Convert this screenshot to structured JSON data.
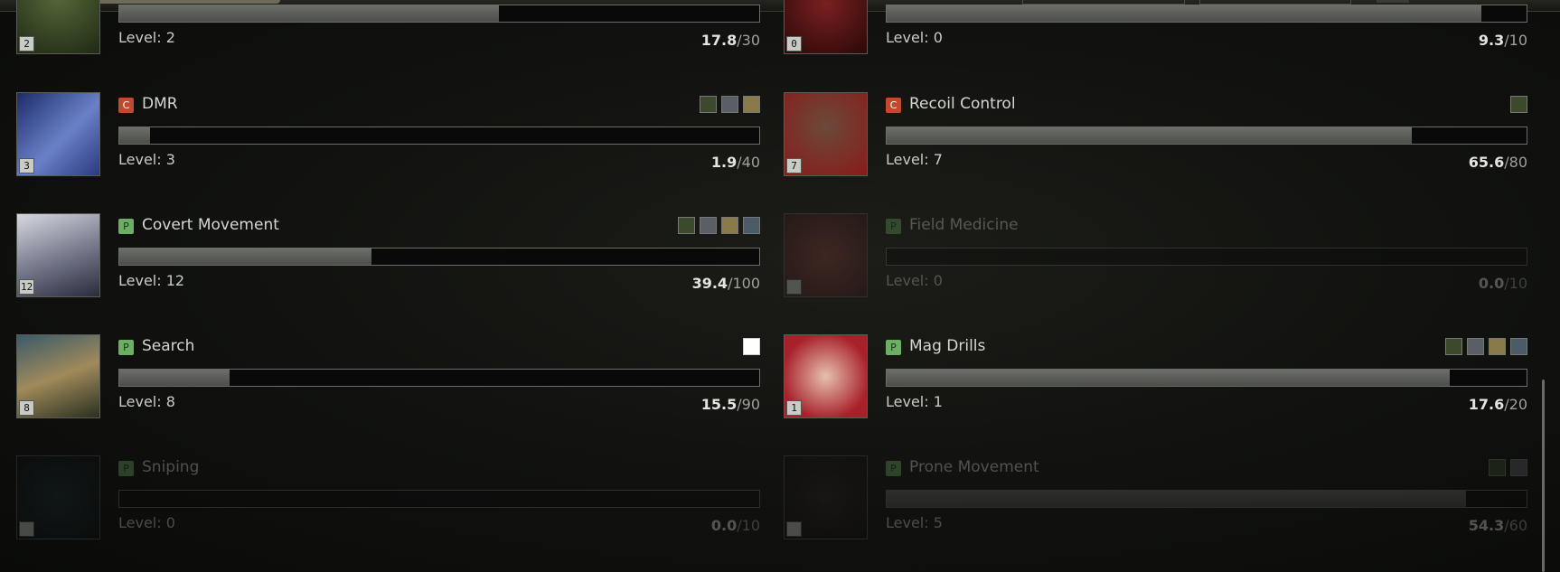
{
  "skills": [
    {
      "name": "",
      "tag": "",
      "level_label": "Level: 2",
      "badge": "2",
      "current": "17.8",
      "max": "/30",
      "progress": 0.593,
      "locked": false,
      "buff_icons": [],
      "icon": "helmet-skill-icon"
    },
    {
      "name": "",
      "tag": "",
      "level_label": "Level: 0",
      "badge": "0",
      "current": "9.3",
      "max": "/10",
      "progress": 0.93,
      "locked": false,
      "buff_icons": [],
      "icon": "rifle-skill-icon"
    },
    {
      "name": "DMR",
      "tag": "C",
      "level_label": "Level: 3",
      "badge": "3",
      "current": "1.9",
      "max": "/40",
      "progress": 0.048,
      "locked": false,
      "buff_icons": [
        "reload-buff-icon",
        "crosshair-buff-icon",
        "rifle-buff-icon"
      ],
      "icon": "dmr-skill-icon"
    },
    {
      "name": "Recoil Control",
      "tag": "C",
      "level_label": "Level: 7",
      "badge": "7",
      "current": "65.6",
      "max": "/80",
      "progress": 0.82,
      "locked": false,
      "buff_icons": [
        "recoil-buff-icon"
      ],
      "icon": "recoil-control-skill-icon"
    },
    {
      "name": "Covert Movement",
      "tag": "P",
      "level_label": "Level: 12",
      "badge": "12",
      "current": "39.4",
      "max": "/100",
      "progress": 0.394,
      "locked": false,
      "buff_icons": [
        "sneak-buff-icon",
        "sneak-buff-icon",
        "stealth-buff-icon",
        "walk-buff-icon"
      ],
      "icon": "covert-movement-skill-icon"
    },
    {
      "name": "Field Medicine",
      "tag": "P",
      "level_label": "Level: 0",
      "badge": "",
      "current": "0.0",
      "max": "/10",
      "progress": 0,
      "locked": true,
      "buff_icons": [],
      "icon": "field-medicine-skill-icon"
    },
    {
      "name": "Search",
      "tag": "P",
      "level_label": "Level: 8",
      "badge": "8",
      "current": "15.5",
      "max": "/90",
      "progress": 0.172,
      "locked": false,
      "buff_icons": [
        "search-buff-icon"
      ],
      "icon": "search-skill-icon"
    },
    {
      "name": "Mag Drills",
      "tag": "P",
      "level_label": "Level: 1",
      "badge": "1",
      "current": "17.6",
      "max": "/20",
      "progress": 0.88,
      "locked": false,
      "buff_icons": [
        "magazine-buff-icon",
        "magazine-buff-icon",
        "magazine-buff-icon",
        "magazine-buff-icon"
      ],
      "icon": "mag-drills-skill-icon"
    },
    {
      "name": "Sniping",
      "tag": "P",
      "level_label": "Level: 0",
      "badge": "",
      "current": "0.0",
      "max": "/10",
      "progress": 0,
      "locked": true,
      "buff_icons": [],
      "icon": "sniping-skill-icon"
    },
    {
      "name": "Prone Movement",
      "tag": "P",
      "level_label": "Level: 5",
      "badge": "",
      "current": "54.3",
      "max": "/60",
      "progress": 0.905,
      "locked": true,
      "buff_icons": [
        "prone-buff-icon",
        "crawl-buff-icon"
      ],
      "icon": "prone-movement-skill-icon"
    }
  ],
  "colors": {
    "tag_c": "#c04a2e",
    "tag_p": "#6cae64",
    "bar_fill": "#5c5e5a"
  }
}
